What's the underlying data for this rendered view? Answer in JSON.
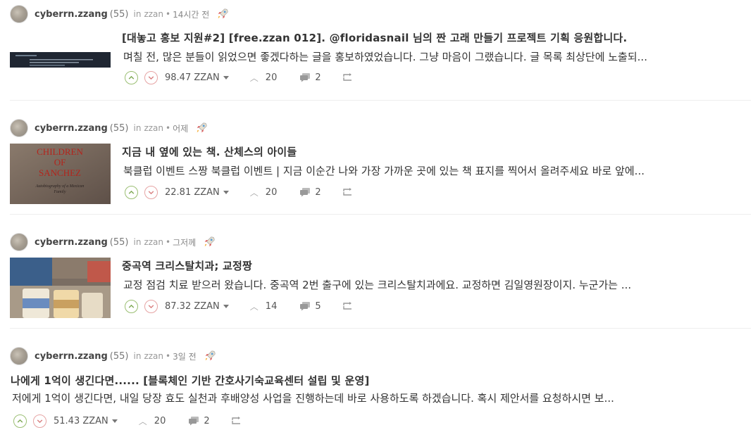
{
  "posts": [
    {
      "author": "cyberrn.zzang",
      "reputation": "(55)",
      "in_label": "in",
      "community": "zzan",
      "dot": "•",
      "time": "14시간 전",
      "title": "[대놓고 홍보 지원#2] [free.zzan 012]. @floridasnail 님의 짠 고래 만들기 프로젝트 기획 응원합니다.",
      "summary": "며칠 전, 많은 분들이 읽었으면 좋겠다하는 글을 홍보하였었습니다. 그냥 마음이 그랬습니다. 글 목록 최상단에 노출되...",
      "payout": "98.47 ZZAN",
      "votes": "20",
      "comments": "2",
      "thumbnail": "dark-screenshot"
    },
    {
      "author": "cyberrn.zzang",
      "reputation": "(55)",
      "in_label": "in",
      "community": "zzan",
      "dot": "•",
      "time": "어제",
      "title": "지금 내 옆에 있는 책. 산체스의 아이들",
      "summary": "북클럽 이벤트 스짱 북클럽 이벤트 | 지금 이순간 나와 가장 가까운 곳에 있는 책 표지를 찍어서 올려주세요 바로 앞에...",
      "payout": "22.81 ZZAN",
      "votes": "20",
      "comments": "2",
      "thumbnail": "book-cover",
      "thumb_text": {
        "line1": "CHILDREN",
        "line2": "OF",
        "line3": "SANCHEZ",
        "line4": "Autobiography of a Mexican",
        "line5": "Family"
      }
    },
    {
      "author": "cyberrn.zzang",
      "reputation": "(55)",
      "in_label": "in",
      "community": "zzan",
      "dot": "•",
      "time": "그저께",
      "title": "중곡역 크리스탈치과; 교정짱",
      "summary": "교정 점검 치료 받으러 왔습니다. 중곡역 2번 출구에 있는 크리스탈치과에요. 교정하면 김일영원장이지. 누군가는 ...",
      "payout": "87.32 ZZAN",
      "votes": "14",
      "comments": "5",
      "thumbnail": "jars-photo"
    },
    {
      "author": "cyberrn.zzang",
      "reputation": "(55)",
      "in_label": "in",
      "community": "zzan",
      "dot": "•",
      "time": "3일 전",
      "title": "나에게 1억이 생긴다면...... [블록체인 기반 간호사기숙교육센터 설립 및 운영]",
      "summary": "저에게 1억이 생긴다면, 내일 당장 효도 실천과 후배양성 사업을 진행하는데 바로 사용하도록 하겠습니다. 혹시 제안서를 요청하시면 보...",
      "payout": "51.43 ZZAN",
      "votes": "20",
      "comments": "2",
      "thumbnail": ""
    }
  ],
  "colors": {
    "upvote": "#9bbf73",
    "downvote": "#e6a4a4",
    "muted": "#999999"
  }
}
